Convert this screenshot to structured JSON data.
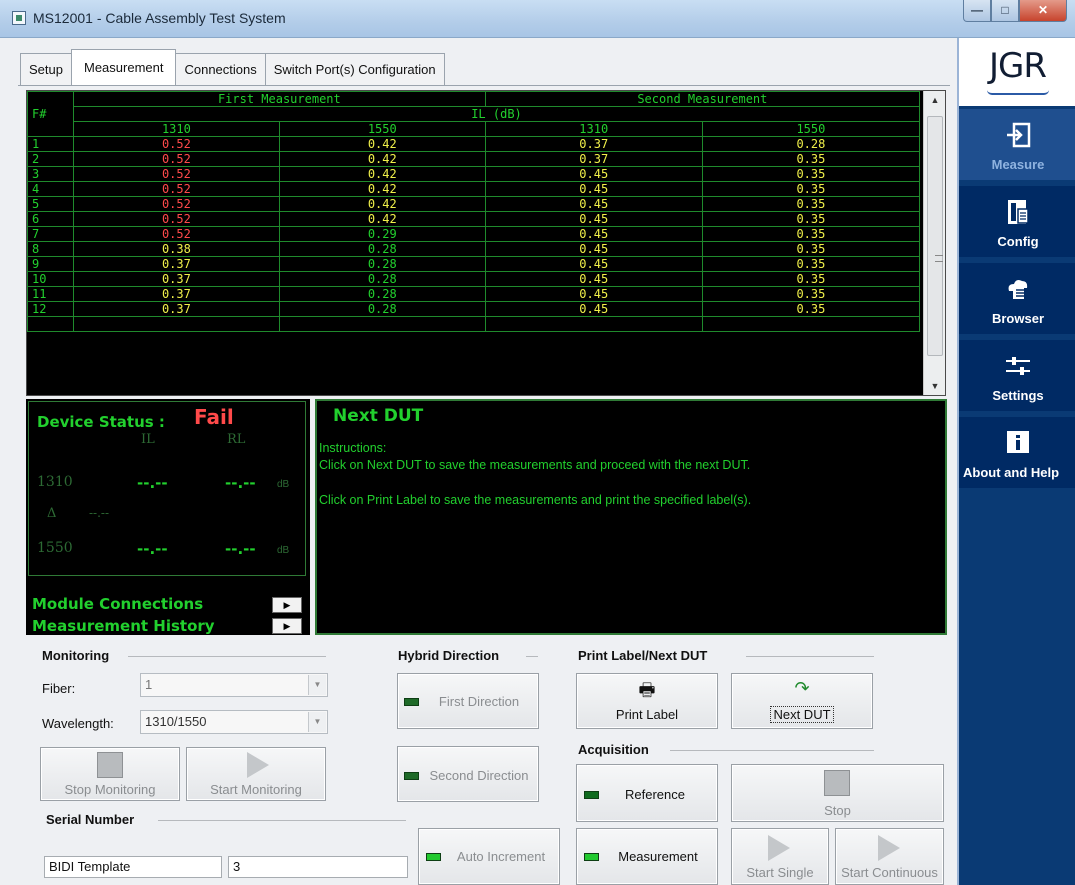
{
  "window": {
    "title": "MS12001 - Cable Assembly Test System"
  },
  "tabs": [
    "Setup",
    "Measurement",
    "Connections",
    "Switch Port(s) Configuration"
  ],
  "table": {
    "group1": "First Measurement",
    "group2": "Second Measurement",
    "fnum_header": "F#",
    "metric": "IL (dB)",
    "wavelengths": [
      "1310",
      "1550",
      "1310",
      "1550"
    ],
    "rows": [
      {
        "f": "1",
        "v": [
          "0.52",
          "0.42",
          "0.37",
          "0.28"
        ],
        "c": [
          "red",
          "yellow",
          "yellow",
          "yellow"
        ]
      },
      {
        "f": "2",
        "v": [
          "0.52",
          "0.42",
          "0.37",
          "0.35"
        ],
        "c": [
          "red",
          "yellow",
          "yellow",
          "yellow"
        ]
      },
      {
        "f": "3",
        "v": [
          "0.52",
          "0.42",
          "0.45",
          "0.35"
        ],
        "c": [
          "red",
          "yellow",
          "yellow",
          "yellow"
        ]
      },
      {
        "f": "4",
        "v": [
          "0.52",
          "0.42",
          "0.45",
          "0.35"
        ],
        "c": [
          "red",
          "yellow",
          "yellow",
          "yellow"
        ]
      },
      {
        "f": "5",
        "v": [
          "0.52",
          "0.42",
          "0.45",
          "0.35"
        ],
        "c": [
          "red",
          "yellow",
          "yellow",
          "yellow"
        ]
      },
      {
        "f": "6",
        "v": [
          "0.52",
          "0.42",
          "0.45",
          "0.35"
        ],
        "c": [
          "red",
          "yellow",
          "yellow",
          "yellow"
        ]
      },
      {
        "f": "7",
        "v": [
          "0.52",
          "0.29",
          "0.45",
          "0.35"
        ],
        "c": [
          "red",
          "green",
          "yellow",
          "yellow"
        ]
      },
      {
        "f": "8",
        "v": [
          "0.38",
          "0.28",
          "0.45",
          "0.35"
        ],
        "c": [
          "yellow",
          "green",
          "yellow",
          "yellow"
        ]
      },
      {
        "f": "9",
        "v": [
          "0.37",
          "0.28",
          "0.45",
          "0.35"
        ],
        "c": [
          "yellow",
          "green",
          "yellow",
          "yellow"
        ]
      },
      {
        "f": "10",
        "v": [
          "0.37",
          "0.28",
          "0.45",
          "0.35"
        ],
        "c": [
          "yellow",
          "green",
          "yellow",
          "yellow"
        ]
      },
      {
        "f": "11",
        "v": [
          "0.37",
          "0.28",
          "0.45",
          "0.35"
        ],
        "c": [
          "yellow",
          "green",
          "yellow",
          "yellow"
        ]
      },
      {
        "f": "12",
        "v": [
          "0.37",
          "0.28",
          "0.45",
          "0.35"
        ],
        "c": [
          "yellow",
          "green",
          "yellow",
          "yellow"
        ]
      }
    ]
  },
  "device_status": {
    "label": "Device Status :",
    "value": "Fail",
    "col_il": "IL",
    "col_rl": "RL",
    "wl1": "1310",
    "wl2": "1550",
    "delta": "Δ",
    "dash": "--.--",
    "unit": "dB"
  },
  "links": {
    "module_connections": "Module Connections",
    "measurement_history": "Measurement History",
    "arrow": "▶"
  },
  "next_panel": {
    "title": "Next DUT",
    "instructions_label": "Instructions:",
    "line1": "Click on Next DUT to save the measurements and proceed with the next DUT.",
    "line2": "Click on Print Label to save the measurements and print the specified label(s)."
  },
  "monitoring": {
    "title": "Monitoring",
    "fiber_label": "Fiber:",
    "fiber_value": "1",
    "wavelength_label": "Wavelength:",
    "wavelength_value": "1310/1550",
    "stop_label": "Stop Monitoring",
    "start_label": "Start Monitoring"
  },
  "hybrid": {
    "title": "Hybrid Direction",
    "first": "First Direction",
    "second": "Second Direction"
  },
  "print": {
    "title": "Print Label/Next DUT",
    "print_label": "Print Label",
    "next_dut": "Next DUT"
  },
  "acquisition": {
    "title": "Acquisition",
    "reference": "Reference",
    "measurement": "Measurement",
    "stop": "Stop",
    "start_single": "Start Single",
    "start_continuous": "Start Continuous"
  },
  "serial": {
    "title": "Serial Number",
    "template": "BIDI Template",
    "number": "3",
    "auto_increment": "Auto Increment"
  },
  "sidebar": {
    "logo": "JGR",
    "items": [
      "Measure",
      "Config",
      "Browser",
      "Settings",
      "About and Help"
    ]
  },
  "colors": {
    "grid_green": "#22d02e",
    "fail_red": "#ff4a4a",
    "warn_yellow": "#f0f04a",
    "sidebar_blue": "#002a64"
  }
}
